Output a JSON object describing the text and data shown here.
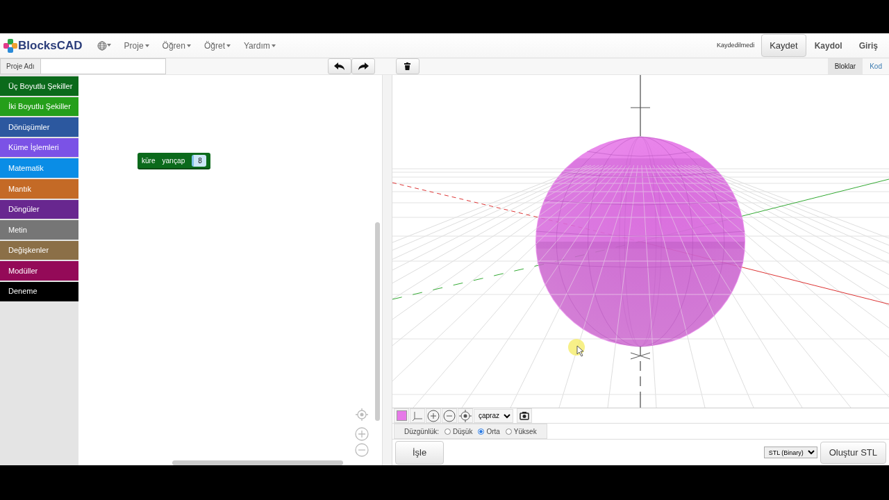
{
  "navbar": {
    "brand": "BlocksCAD",
    "menus": [
      {
        "label": "Proje"
      },
      {
        "label": "Öğren"
      },
      {
        "label": "Öğret"
      },
      {
        "label": "Yardım"
      }
    ],
    "save_status": "Kaydedilmedi",
    "save_button": "Kaydet",
    "links": [
      "Kaydol",
      "Giriş"
    ]
  },
  "toolbar": {
    "project_name_label": "Proje Adı",
    "view_tabs": [
      {
        "label": "Bloklar",
        "selected": true
      },
      {
        "label": "Kod",
        "selected": false
      }
    ]
  },
  "categories": [
    {
      "label": "Üç Boyutlu Şekiller",
      "color": "#0b6a1b"
    },
    {
      "label": "İki Boyutlu Şekiller",
      "color": "#259f1a"
    },
    {
      "label": "Dönüşümler",
      "color": "#2c589f"
    },
    {
      "label": "Küme İşlemleri",
      "color": "#7b52e6"
    },
    {
      "label": "Matematik",
      "color": "#0a8de6"
    },
    {
      "label": "Mantık",
      "color": "#c46a26"
    },
    {
      "label": "Döngüler",
      "color": "#68278f"
    },
    {
      "label": "Metin",
      "color": "#767676"
    },
    {
      "label": "Değişkenler",
      "color": "#8b6f47"
    },
    {
      "label": "Modüller",
      "color": "#940a58"
    },
    {
      "label": "Deneme",
      "color": "#000000"
    }
  ],
  "block": {
    "label": "küre",
    "parameter": "yarıçap",
    "value": "8"
  },
  "viewer": {
    "view_select": "çapraz",
    "smoothness": {
      "label": "Düzgünlük:",
      "options": [
        {
          "label": "Düşük",
          "selected": false
        },
        {
          "label": "Orta",
          "selected": true
        },
        {
          "label": "Yüksek",
          "selected": false
        }
      ]
    },
    "render_button": "İşle",
    "export_format": "STL (Binary)",
    "export_button": "Oluştur STL"
  }
}
